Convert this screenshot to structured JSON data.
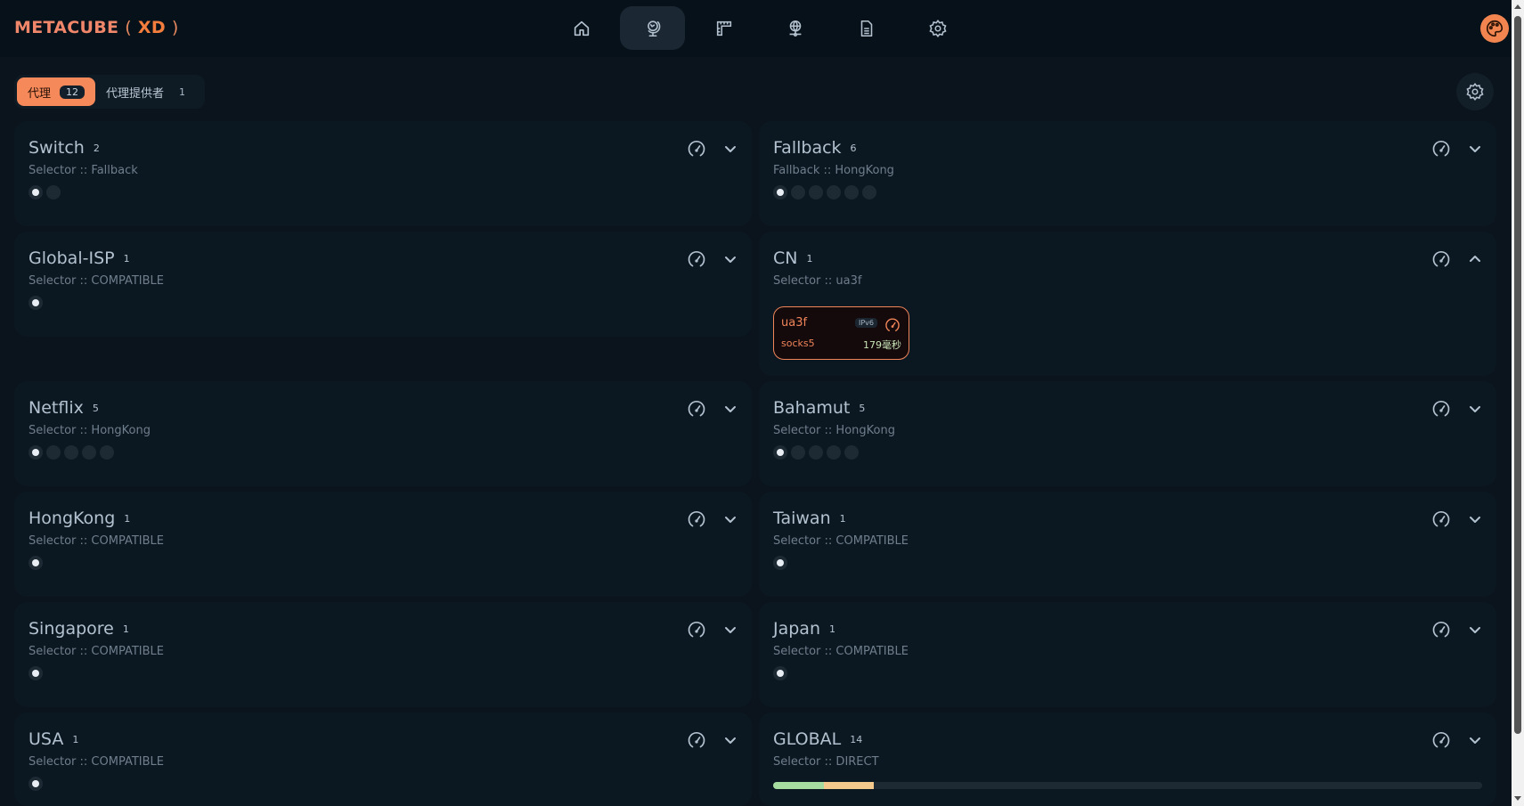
{
  "app": {
    "logo_main": "METACUBE",
    "logo_open": "(",
    "logo_xd": "XD",
    "logo_close": ")",
    "nav": [
      {
        "icon": "home-icon",
        "active": false
      },
      {
        "icon": "globe-stand-icon",
        "active": true
      },
      {
        "icon": "ruler-icon",
        "active": false
      },
      {
        "icon": "network-globe-icon",
        "active": false
      },
      {
        "icon": "document-icon",
        "active": false
      },
      {
        "icon": "gear-icon",
        "active": false
      }
    ],
    "theme_icon": "palette-icon"
  },
  "tabs": [
    {
      "label": "代理",
      "count": "12",
      "active": true
    },
    {
      "label": "代理提供者",
      "count": "1",
      "active": false
    }
  ],
  "groups": [
    {
      "name": "Switch",
      "count": "2",
      "subtitle": "Selector :: Fallback",
      "dots": 2
    },
    {
      "name": "Fallback",
      "count": "6",
      "subtitle": "Fallback :: HongKong",
      "dots": 6
    },
    {
      "name": "Global-ISP",
      "count": "1",
      "subtitle": "Selector :: COMPATIBLE",
      "dots": 1
    },
    {
      "name": "CN",
      "count": "1",
      "subtitle": "Selector :: ua3f",
      "expanded": true,
      "node": {
        "name": "ua3f",
        "tag": "IPv6",
        "type": "socks5",
        "delay": "179毫秒"
      }
    },
    {
      "name": "Netflix",
      "count": "5",
      "subtitle": "Selector :: HongKong",
      "dots": 5
    },
    {
      "name": "Bahamut",
      "count": "5",
      "subtitle": "Selector :: HongKong",
      "dots": 5
    },
    {
      "name": "HongKong",
      "count": "1",
      "subtitle": "Selector :: COMPATIBLE",
      "dots": 1
    },
    {
      "name": "Taiwan",
      "count": "1",
      "subtitle": "Selector :: COMPATIBLE",
      "dots": 1
    },
    {
      "name": "Singapore",
      "count": "1",
      "subtitle": "Selector :: COMPATIBLE",
      "dots": 1
    },
    {
      "name": "Japan",
      "count": "1",
      "subtitle": "Selector :: COMPATIBLE",
      "dots": 1
    },
    {
      "name": "USA",
      "count": "1",
      "subtitle": "Selector :: COMPATIBLE",
      "dots": 1
    },
    {
      "name": "GLOBAL",
      "count": "14",
      "subtitle": "Selector :: DIRECT",
      "latency_bar": [
        {
          "color": "#a6dca0",
          "fraction": 0.071
        },
        {
          "color": "#f5c98c",
          "fraction": 0.071
        }
      ]
    }
  ],
  "colors": {
    "accent": "#f5895a",
    "background": "#0b141c",
    "card": "#0c1821"
  }
}
